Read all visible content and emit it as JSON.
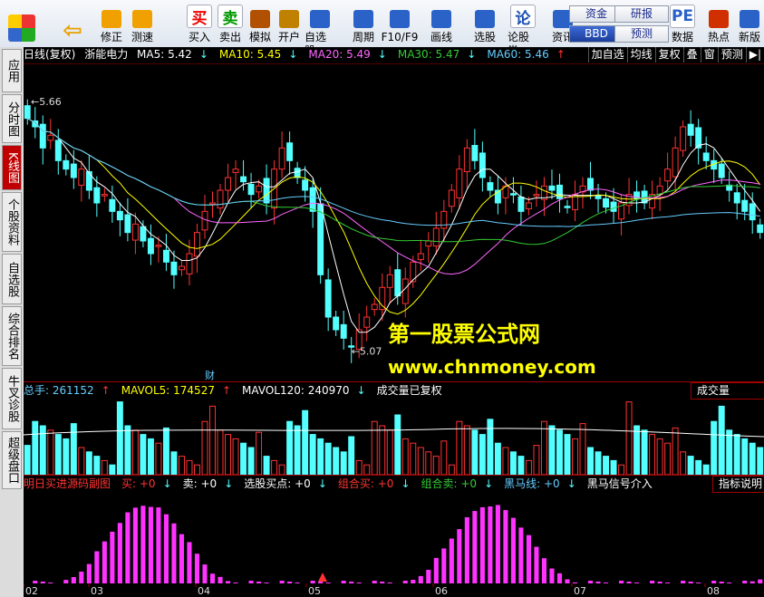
{
  "toolbar": {
    "items": [
      {
        "label": "修正",
        "icon": "up-down-arrow-icon"
      },
      {
        "label": "测速",
        "icon": "clock-icon"
      },
      {
        "label": "买入",
        "icon": "buy-icon",
        "glyph": "买"
      },
      {
        "label": "卖出",
        "icon": "sell-icon",
        "glyph": "卖"
      },
      {
        "label": "模拟",
        "icon": "hammer-icon"
      },
      {
        "label": "开户",
        "icon": "lock-icon"
      },
      {
        "label": "自选股",
        "icon": "star-icon"
      },
      {
        "label": "周期",
        "icon": "period-clock-icon"
      },
      {
        "label": "F10/F9",
        "icon": "f10-icon"
      },
      {
        "label": "画线",
        "icon": "pen-icon"
      },
      {
        "label": "选股",
        "icon": "select-stock-icon"
      },
      {
        "label": "论股堂",
        "icon": "forum-icon",
        "glyph": "论"
      },
      {
        "label": "资讯",
        "icon": "news-icon"
      },
      {
        "label": "数据",
        "icon": "pe-data-icon",
        "glyph": "PE"
      },
      {
        "label": "热点",
        "icon": "hot-icon"
      },
      {
        "label": "新版",
        "icon": "new-version-icon"
      }
    ],
    "small_buttons": [
      "资金",
      "研报",
      "BBD",
      "预测"
    ]
  },
  "sidebar": {
    "tabs": [
      "应用",
      "分时图",
      "K线图",
      "个股资料",
      "自选股",
      "综合排名",
      "牛叉诊股",
      "超级盘口"
    ],
    "active_index": 2
  },
  "main": {
    "title": "日线(复权)",
    "stock_name": "浙能电力",
    "ma": [
      {
        "label": "MA5: 5.42",
        "arrow": "↓",
        "color": "#ffffff"
      },
      {
        "label": "MA10: 5.45",
        "arrow": "↓",
        "color": "#ffff00"
      },
      {
        "label": "MA20: 5.49",
        "arrow": "↓",
        "color": "#ff66ff"
      },
      {
        "label": "MA30: 5.47",
        "arrow": "↓",
        "color": "#33cc33"
      },
      {
        "label": "MA60: 5.46",
        "arrow": "↑",
        "color": "#66ccff"
      }
    ],
    "right_buttons": [
      "加自选",
      "均线",
      "复权",
      "叠",
      "窗",
      "预测",
      "▶|"
    ],
    "high_label": "5.66",
    "low_label": "5.07",
    "event_marker": "财"
  },
  "volume": {
    "header": [
      {
        "label": "总手: 261152",
        "arrow": "↑",
        "color": "#66ccff"
      },
      {
        "label": "MAVOL5: 174527",
        "arrow": "↑",
        "color": "#ffff00"
      },
      {
        "label": "MAVOL120: 240970",
        "arrow": "↓",
        "color": "#ffffff"
      },
      {
        "label": "成交量已复权",
        "arrow": "",
        "color": "#ffffff"
      }
    ],
    "label_box": "成交量"
  },
  "indicator": {
    "header": [
      {
        "label": "明日买进源码副图",
        "color": "#ff3333"
      },
      {
        "label": "买: +0",
        "arrow": "↓",
        "color": "#ff3333"
      },
      {
        "label": "卖: +0",
        "arrow": "↓",
        "color": "#ffffff"
      },
      {
        "label": "选股买点: +0",
        "arrow": "↓",
        "color": "#ffffff"
      },
      {
        "label": "组合买: +0",
        "arrow": "↓",
        "color": "#ff3333"
      },
      {
        "label": "组合卖: +0",
        "arrow": "↓",
        "color": "#33cc33"
      },
      {
        "label": "黑马线: +0",
        "arrow": "↓",
        "color": "#66ccff"
      },
      {
        "label": "黑马信号介入",
        "arrow": "",
        "color": "#ffffff"
      }
    ],
    "label_box": "指标说明"
  },
  "x_axis": [
    "02",
    "03",
    "04",
    "05",
    "06",
    "07",
    "08"
  ],
  "watermark": {
    "line1": "第一股票公式网",
    "line2": "www.chnmoney.com"
  },
  "colors": {
    "up": "#ff3232",
    "down": "#54ffff",
    "ma5": "#ffffff",
    "ma10": "#ffff00",
    "ma20": "#ff66ff",
    "ma30": "#33cc33",
    "ma60": "#66ccff",
    "indicator": "#ff33ff"
  },
  "chart_data": {
    "type": "candlestick",
    "price_range": [
      5.0,
      5.75
    ],
    "closes": [
      5.62,
      5.6,
      5.55,
      5.58,
      5.52,
      5.5,
      5.48,
      5.5,
      5.45,
      5.42,
      5.44,
      5.4,
      5.38,
      5.35,
      5.37,
      5.33,
      5.3,
      5.32,
      5.28,
      5.25,
      5.27,
      5.3,
      5.35,
      5.4,
      5.42,
      5.45,
      5.48,
      5.5,
      5.47,
      5.44,
      5.46,
      5.42,
      5.5,
      5.55,
      5.52,
      5.48,
      5.45,
      5.4,
      5.25,
      5.15,
      5.12,
      5.1,
      5.08,
      5.12,
      5.15,
      5.18,
      5.22,
      5.25,
      5.2,
      5.24,
      5.28,
      5.3,
      5.33,
      5.36,
      5.4,
      5.45,
      5.5,
      5.55,
      5.52,
      5.48,
      5.45,
      5.42,
      5.46,
      5.44,
      5.4,
      5.42,
      5.44,
      5.46,
      5.45,
      5.43,
      5.41,
      5.44,
      5.46,
      5.45,
      5.43,
      5.41,
      5.4,
      5.42,
      5.44,
      5.43,
      5.42,
      5.44,
      5.46,
      5.5,
      5.55,
      5.6,
      5.58,
      5.55,
      5.52,
      5.5,
      5.48,
      5.45,
      5.42,
      5.4,
      5.38,
      5.35
    ],
    "volume_range": [
      0,
      700000
    ],
    "indicator_range": [
      0,
      100
    ]
  }
}
